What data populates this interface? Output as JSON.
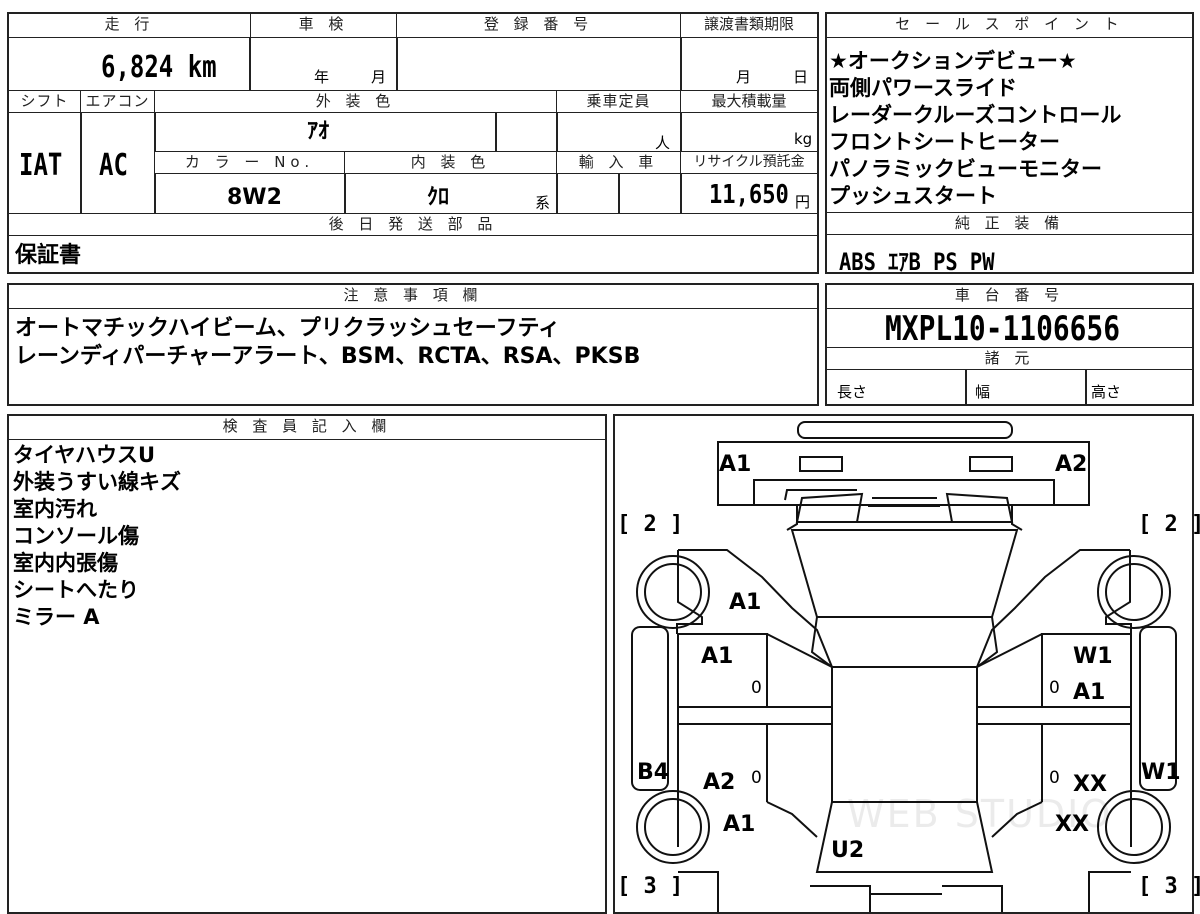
{
  "top": {
    "mileage_label": "走 行",
    "mileage_value": "6,824 km",
    "shaken_label": "車 検",
    "shaken_year": "年",
    "shaken_month": "月",
    "reg_label": "登 録 番 号",
    "transfer_label": "譲渡書類期限",
    "transfer_month": "月",
    "transfer_day": "日",
    "shift_label": "シフト",
    "shift_value": "IAT",
    "ac_label": "エアコン",
    "ac_value": "AC",
    "ext_color_label": "外 装 色",
    "ext_color_value": "ｱｵ",
    "capacity_label": "乗車定員",
    "capacity_unit": "人",
    "maxload_label": "最大積載量",
    "maxload_unit": "kg",
    "color_no_label": "カ ラ ー No.",
    "color_no_value": "8W2",
    "int_color_label": "内 装 色",
    "int_color_value": "ｸﾛ",
    "int_color_suffix": "系",
    "import_label": "輸 入 車",
    "recycle_label": "リサイクル預託金",
    "recycle_value": "11,650",
    "recycle_unit": "円",
    "later_label": "後 日 発 送 部 品",
    "later_value": "保証書"
  },
  "sales": {
    "label": "セ ー ル ス ポ イ ン ト",
    "points": [
      "★オークションデビュー★",
      "両側パワースライド",
      "レーダークルーズコントロール",
      "フロントシートヒーター",
      "パノラミックビューモニター",
      "プッシュスタート"
    ]
  },
  "equipment": {
    "label": "純 正 装 備",
    "value": "ABS ｴｱB PS PW"
  },
  "notes": {
    "label": "注 意 事 項 欄",
    "lines": [
      "オートマチックハイビーム、プリクラッシュセーフティ",
      "レーンディパーチャーアラート、BSM、RCTA、RSA、PKSB"
    ]
  },
  "chassis": {
    "label": "車 台 番 号",
    "value": "MXPL10-1106656",
    "specs_label": "諸 元",
    "length_label": "長さ",
    "width_label": "幅",
    "height_label": "高さ"
  },
  "inspector": {
    "label": "検 査 員 記 入 欄",
    "lines": [
      "タイヤハウスU",
      "外装うすい線キズ",
      "室内汚れ",
      "コンソール傷",
      "室内内張傷",
      "シートへたり",
      "ミラー A"
    ]
  },
  "diagram": {
    "front_left": "A1",
    "front_right": "A2",
    "bracket_fl": "[ 2 ]",
    "bracket_fr": "[ 2 ]",
    "bracket_rl": "[ 3 ]",
    "bracket_rr": "[ 3 ]",
    "fender_left": "A1",
    "door_fl": "A1",
    "door_fl_zero": "0",
    "door_fr": "W1",
    "door_fr_zero": "0",
    "door_fr_mark": "A1",
    "side_left": "B4",
    "door_rl": "A2",
    "door_rl_zero": "0",
    "door_rr_zero": "0",
    "door_rr_mark": "XX",
    "side_right": "W1",
    "rear_fender_left": "A1",
    "rear_fender_right": "XX",
    "rear_mark": "U2",
    "watermark": "WEB STUDIO"
  }
}
